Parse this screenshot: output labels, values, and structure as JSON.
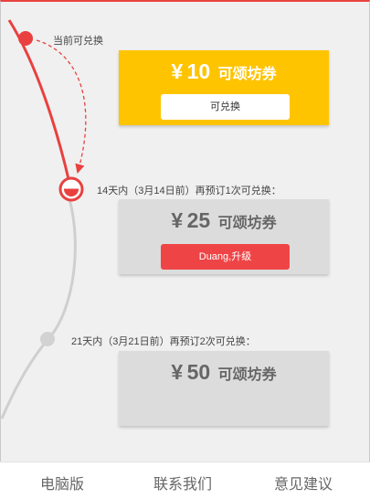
{
  "timeline": {
    "steps": [
      {
        "label": "当前可兑换",
        "currency": "¥",
        "amount": "10",
        "unit": "可颂坊券",
        "button": "可兑换",
        "state": "active"
      },
      {
        "label": "14天内（3月14日前）再预订1次可兑换：",
        "currency": "¥",
        "amount": "25",
        "unit": "可颂坊券",
        "button": "Duang,升级",
        "state": "next"
      },
      {
        "label": "21天内（3月21日前）再预订2次可兑换：",
        "currency": "¥",
        "amount": "50",
        "unit": "可颂坊券",
        "state": "locked"
      }
    ]
  },
  "footer": {
    "items": [
      "电脑版",
      "联系我们",
      "意见建议"
    ]
  },
  "colors": {
    "accent_red": "#e8413f",
    "gold": "#ffc400",
    "card_gray": "#dcdcdc",
    "button_red": "#ef4446"
  }
}
